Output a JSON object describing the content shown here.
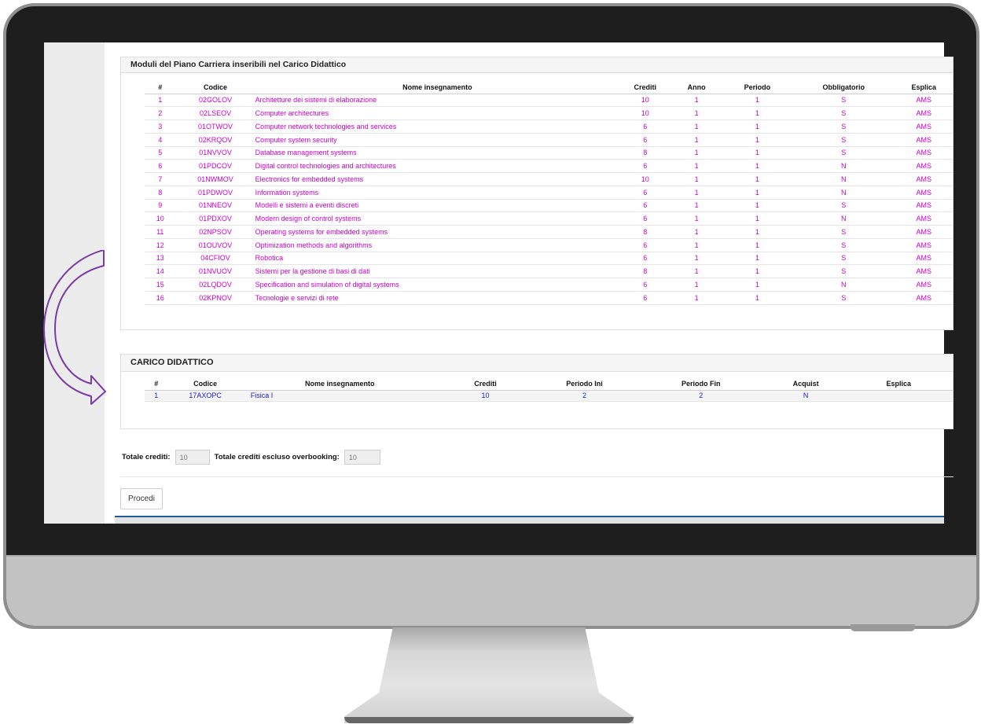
{
  "moduli": {
    "title": "Moduli del Piano Carriera inseribili nel Carico Didattico",
    "headers": [
      "#",
      "Codice",
      "Nome insegnamento",
      "Crediti",
      "Anno",
      "Periodo",
      "Obbligatorio",
      "Esplica"
    ],
    "rows": [
      [
        "1",
        "02GOLOV",
        "Architetture dei sistemi di elaborazione",
        "10",
        "1",
        "1",
        "S",
        "AMS"
      ],
      [
        "2",
        "02LSEOV",
        "Computer architectures",
        "10",
        "1",
        "1",
        "S",
        "AMS"
      ],
      [
        "3",
        "01OTWOV",
        "Computer network technologies and services",
        "6",
        "1",
        "1",
        "S",
        "AMS"
      ],
      [
        "4",
        "02KRQOV",
        "Computer system security",
        "6",
        "1",
        "1",
        "S",
        "AMS"
      ],
      [
        "5",
        "01NVVOV",
        "Database management systems",
        "8",
        "1",
        "1",
        "S",
        "AMS"
      ],
      [
        "6",
        "01PDCOV",
        "Digital control technologies and architectures",
        "6",
        "1",
        "1",
        "N",
        "AMS"
      ],
      [
        "7",
        "01NWMOV",
        "Electronics for embedded systems",
        "10",
        "1",
        "1",
        "N",
        "AMS"
      ],
      [
        "8",
        "01PDWOV",
        "Information systems",
        "6",
        "1",
        "1",
        "N",
        "AMS"
      ],
      [
        "9",
        "01NNEOV",
        "Modelli e sistemi a eventi discreti",
        "6",
        "1",
        "1",
        "S",
        "AMS"
      ],
      [
        "10",
        "01PDXOV",
        "Modern design of control systems",
        "6",
        "1",
        "1",
        "N",
        "AMS"
      ],
      [
        "11",
        "02NPSOV",
        "Operating systems for embedded systems",
        "8",
        "1",
        "1",
        "S",
        "AMS"
      ],
      [
        "12",
        "01OUVOV",
        "Optimization methods and algorithms",
        "6",
        "1",
        "1",
        "S",
        "AMS"
      ],
      [
        "13",
        "04CFIOV",
        "Robotica",
        "6",
        "1",
        "1",
        "S",
        "AMS"
      ],
      [
        "14",
        "01NVUOV",
        "Sistemi per la gestione di basi di dati",
        "8",
        "1",
        "1",
        "S",
        "AMS"
      ],
      [
        "15",
        "02LQDOV",
        "Specification and simulation of digital systems",
        "6",
        "1",
        "1",
        "N",
        "AMS"
      ],
      [
        "16",
        "02KPNOV",
        "Tecnologie e servizi di rete",
        "6",
        "1",
        "1",
        "S",
        "AMS"
      ]
    ]
  },
  "carico": {
    "title": "CARICO DIDATTICO",
    "headers": [
      "#",
      "Codice",
      "Nome insegnamento",
      "Crediti",
      "Periodo Ini",
      "Periodo Fin",
      "Acquist",
      "Esplica"
    ],
    "rows": [
      [
        "1",
        "17AXOPC",
        "Fisica I",
        "10",
        "2",
        "2",
        "N",
        ""
      ]
    ]
  },
  "totals": {
    "crediti_label": "Totale crediti:",
    "crediti_value": "10",
    "overbooking_label": "Totale crediti escluso overbooking:",
    "overbooking_value": "10"
  },
  "actions": {
    "procedi_label": "Procedi"
  },
  "colors": {
    "moduli_link": "#cc00cc",
    "carico_link": "#1a1ad9",
    "arrow": "#7a3aa8"
  }
}
